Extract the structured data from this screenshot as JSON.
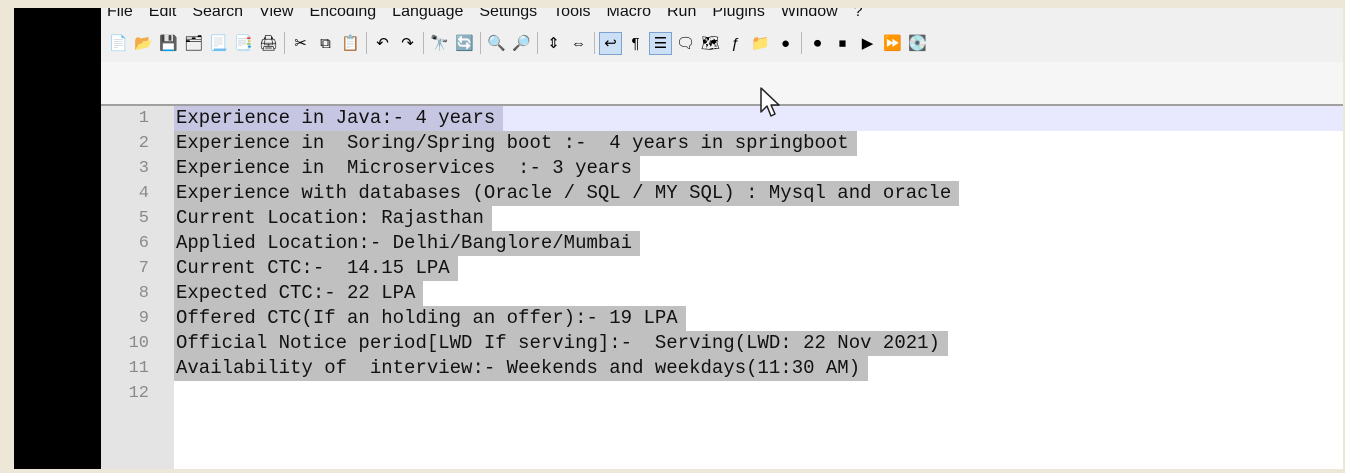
{
  "menu": [
    "File",
    "Edit",
    "Search",
    "View",
    "Encoding",
    "Language",
    "Settings",
    "Tools",
    "Macro",
    "Run",
    "Plugins",
    "Window",
    "?"
  ],
  "toolbar": {
    "groups": [
      [
        {
          "name": "new-file-icon",
          "glyph": "📄"
        },
        {
          "name": "open-file-icon",
          "glyph": "📂"
        },
        {
          "name": "save-icon",
          "glyph": "💾"
        },
        {
          "name": "save-all-icon",
          "glyph": "🗂"
        },
        {
          "name": "close-icon",
          "glyph": "📃"
        },
        {
          "name": "close-all-icon",
          "glyph": "📑"
        },
        {
          "name": "print-icon",
          "glyph": "🖨"
        }
      ],
      [
        {
          "name": "cut-icon",
          "glyph": "✂"
        },
        {
          "name": "copy-icon",
          "glyph": "⧉"
        },
        {
          "name": "paste-icon",
          "glyph": "📋"
        }
      ],
      [
        {
          "name": "undo-icon",
          "glyph": "↶"
        },
        {
          "name": "redo-icon",
          "glyph": "↷"
        }
      ],
      [
        {
          "name": "find-icon",
          "glyph": "🔭"
        },
        {
          "name": "replace-icon",
          "glyph": "🔄"
        }
      ],
      [
        {
          "name": "zoom-in-icon",
          "glyph": "🔍"
        },
        {
          "name": "zoom-out-icon",
          "glyph": "🔎"
        }
      ],
      [
        {
          "name": "sync-vertical-icon",
          "glyph": "⇕"
        },
        {
          "name": "sync-horizontal-icon",
          "glyph": "⇔"
        }
      ],
      [
        {
          "name": "word-wrap-icon",
          "glyph": "↩",
          "active": true
        },
        {
          "name": "show-all-characters-icon",
          "glyph": "¶"
        },
        {
          "name": "indent-guide-icon",
          "glyph": "☰",
          "active": true
        },
        {
          "name": "user-defined-language-icon",
          "glyph": "🗨"
        },
        {
          "name": "document-map-icon",
          "glyph": "🗺"
        },
        {
          "name": "function-list-icon",
          "glyph": "ƒ"
        },
        {
          "name": "folder-as-workspace-icon",
          "glyph": "📁"
        },
        {
          "name": "monitoring-icon",
          "glyph": "●"
        }
      ],
      [
        {
          "name": "record-macro-icon",
          "glyph": "⏺"
        },
        {
          "name": "stop-recording-icon",
          "glyph": "⏹"
        },
        {
          "name": "playback-macro-icon",
          "glyph": "▶"
        },
        {
          "name": "run-macro-multiple-icon",
          "glyph": "⏩"
        },
        {
          "name": "save-macro-icon",
          "glyph": "💽"
        }
      ]
    ]
  },
  "editor": {
    "current_line": 1,
    "lines": [
      {
        "num": "1",
        "text": "Experience in Java:- 4 years"
      },
      {
        "num": "2",
        "text": "Experience in  Soring/Spring boot :-  4 years in springboot"
      },
      {
        "num": "3",
        "text": "Experience in  Microservices  :- 3 years"
      },
      {
        "num": "4",
        "text": "Experience with databases (Oracle / SQL / MY SQL) : Mysql and oracle"
      },
      {
        "num": "5",
        "text": "Current Location: Rajasthan"
      },
      {
        "num": "6",
        "text": "Applied Location:- Delhi/Banglore/Mumbai"
      },
      {
        "num": "7",
        "text": "Current CTC:-  14.15 LPA"
      },
      {
        "num": "8",
        "text": "Expected CTC:- 22 LPA"
      },
      {
        "num": "9",
        "text": "Offered CTC(If an holding an offer):- 19 LPA"
      },
      {
        "num": "10",
        "text": "Official Notice period[LWD If serving]:-  Serving(LWD: 22 Nov 2021)"
      },
      {
        "num": "11",
        "text": "Availability of  interview:- Weekends and weekdays(11:30 AM)"
      },
      {
        "num": "12",
        "text": ""
      }
    ]
  }
}
